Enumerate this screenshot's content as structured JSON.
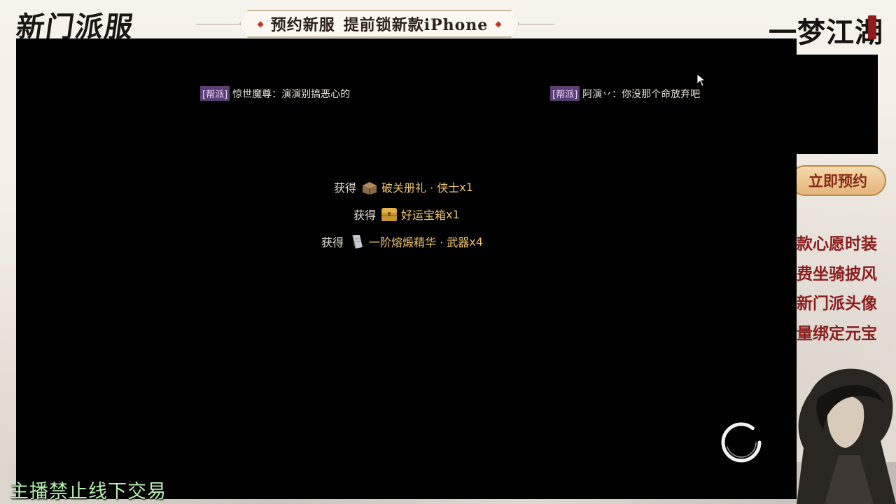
{
  "stream_overlay": {
    "logo_left": "新门派服",
    "logo_right": "一梦江湖",
    "banner": {
      "text_left": "预约新服",
      "text_right": "提前锁新款iPhone"
    },
    "reserve_button_label": "立即预约",
    "promo_items": [
      "款心愿时装",
      "费坐骑披风",
      "新门派头像",
      "量绑定元宝"
    ],
    "caption": "主播禁止线下交易"
  },
  "game": {
    "chat": [
      {
        "tag": "[帮派]",
        "text": "惊世魔尊：演演别搞恶心的"
      },
      {
        "tag": "[帮派]",
        "text": "阿演丷：你没那个命放弃吧"
      }
    ],
    "rewards": [
      {
        "prefix": "获得",
        "item": "破关册礼 · 侠士",
        "count": "x1",
        "icon": "book-gift-icon"
      },
      {
        "prefix": "获得",
        "item": "好运宝箱",
        "count": "x1",
        "icon": "treasure-chest-icon"
      },
      {
        "prefix": "获得",
        "item": "一阶熔煅精华 · 武器",
        "count": "x4",
        "icon": "scroll-essence-icon"
      }
    ]
  },
  "colors": {
    "chat_tag_bg": "#5b3f75",
    "reward_item": "#f0c66a",
    "promo_text": "#8b1e1e",
    "caption_text": "#b8f0b0"
  }
}
